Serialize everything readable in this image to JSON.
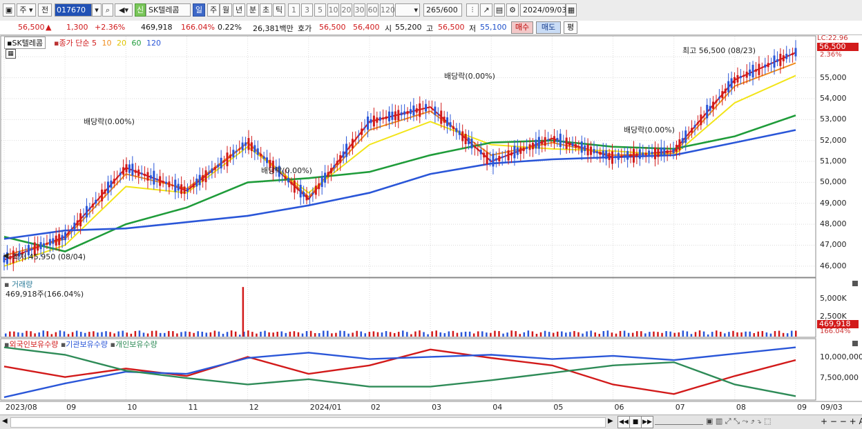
{
  "toolbar": {
    "period_week": "주",
    "prev_label": "전",
    "stock_code": "017670",
    "market_badge": "신",
    "stock_name": "SK텔레콤",
    "period_tabs": [
      "일",
      "주",
      "월",
      "년",
      "분",
      "초",
      "틱"
    ],
    "interval_buttons": [
      "1",
      "3",
      "5",
      "10",
      "20",
      "30",
      "60",
      "120"
    ],
    "count_value": "265",
    "count_total": "/600",
    "date_value": "2024/09/03"
  },
  "quote": {
    "price": "56,500",
    "up_arrow": "▲",
    "change": "1,300",
    "change_pct": "+2.36%",
    "volume": "469,918",
    "volume_ratio": "166.04%",
    "turnover": "0.22%",
    "amount": "26,381백만",
    "bid_ask_label": "호가",
    "ask_price": "56,500",
    "bid_price": "56,400",
    "open_label": "시",
    "open": "55,200",
    "high_label": "고",
    "high": "56,500",
    "low_label": "저",
    "low": "55,100",
    "buy_button": "매수",
    "sell_button": "매도",
    "eval_button": "평"
  },
  "price_panel": {
    "title": "SK텔레콤",
    "indicator": "종가 단순",
    "ma_labels": [
      "5",
      "10",
      "20",
      "60",
      "120"
    ],
    "ma_colors": [
      "#d21a1a",
      "#f08c1c",
      "#f2e418",
      "#1f9c3a",
      "#2a56d8"
    ],
    "y_ticks": [
      "56,000",
      "55,000",
      "54,000",
      "53,000",
      "52,000",
      "51,000",
      "50,000",
      "49,000",
      "48,000",
      "47,000",
      "46,000"
    ],
    "current_price_tag": "56,500",
    "current_pct_tag": "2.36%",
    "top_label": "LC:22.96",
    "high_annotation": "최고 56,500 (08/23)",
    "low_annotation": "최저 45,950 (08/04)",
    "dividend_labels": [
      "배당락(0.00%)",
      "배당락(0.00%)",
      "배당락(0.00%)",
      "배당락(0.00%)"
    ]
  },
  "volume_panel": {
    "title": "거래량",
    "value_label": "469,918주(166.04%)",
    "y_ticks": [
      "5,000K",
      "2,500K"
    ],
    "current_tag": "469,918",
    "current_pct_tag": "166.04%"
  },
  "holdings_panel": {
    "legend": [
      "외국인보유수량",
      "기관보유수량",
      "개인보유수량"
    ],
    "colors": [
      "#d21a1a",
      "#2a56d8",
      "#2e8b57"
    ],
    "y_ticks": [
      "10,000,000",
      "7,500,000"
    ]
  },
  "x_axis": {
    "labels": [
      "2023/08",
      "09",
      "10",
      "11",
      "12",
      "2024/01",
      "02",
      "03",
      "04",
      "05",
      "06",
      "07",
      "08",
      "09",
      "09/03"
    ]
  },
  "chart_data": {
    "type": "line",
    "title": "SK텔레콤",
    "x": [
      "2023/08",
      "09",
      "10",
      "11",
      "12",
      "2024/01",
      "02",
      "03",
      "04",
      "05",
      "06",
      "07",
      "08",
      "09"
    ],
    "ylim": [
      45500,
      56700
    ],
    "series": [
      {
        "name": "5",
        "values": [
          46300,
          47400,
          50700,
          49600,
          51900,
          49200,
          52900,
          53600,
          51000,
          52100,
          51200,
          51500,
          54900,
          56200
        ]
      },
      {
        "name": "10",
        "values": [
          46500,
          47300,
          50400,
          49700,
          51900,
          49300,
          52500,
          53400,
          51300,
          51900,
          51300,
          51400,
          54600,
          55700
        ]
      },
      {
        "name": "20",
        "values": [
          46000,
          47000,
          49800,
          49500,
          51700,
          49500,
          51800,
          52900,
          51800,
          51600,
          51500,
          51300,
          53800,
          55100
        ]
      },
      {
        "name": "60",
        "values": [
          47400,
          46700,
          48000,
          48800,
          50000,
          50200,
          50500,
          51300,
          51900,
          52000,
          51700,
          51600,
          52200,
          53200
        ]
      },
      {
        "name": "120",
        "values": [
          47300,
          47700,
          47800,
          48100,
          48400,
          48900,
          49500,
          50400,
          50900,
          51100,
          51200,
          51300,
          51900,
          52500
        ]
      }
    ],
    "volume": {
      "ylim": [
        0,
        6000000
      ],
      "labels": [
        "5,000K",
        "2,500K"
      ],
      "spike_month": "12",
      "spike_value": 5600000,
      "last_value": 469918
    },
    "holdings": {
      "series": [
        {
          "name": "외국인보유수량",
          "values": [
            8900000,
            7900000,
            8700000,
            8000000,
            9800000,
            8200000,
            9000000,
            10500000,
            9700000,
            9000000,
            7200000,
            6300000,
            8000000,
            9500000
          ]
        },
        {
          "name": "기관보유수량",
          "values": [
            6000000,
            7300000,
            8400000,
            8200000,
            9700000,
            10200000,
            9600000,
            9800000,
            10000000,
            9600000,
            9900000,
            9500000,
            10100000,
            10700000
          ]
        },
        {
          "name": "개인보유수량",
          "values": [
            10700000,
            10000000,
            8500000,
            7800000,
            7200000,
            7700000,
            7000000,
            7000000,
            7600000,
            8300000,
            9000000,
            9300000,
            7200000,
            6100000
          ]
        }
      ]
    }
  }
}
